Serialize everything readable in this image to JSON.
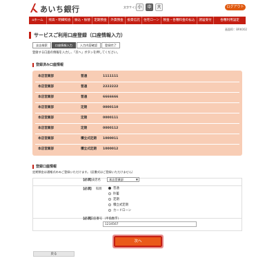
{
  "header": {
    "bank_name": "あいち銀行",
    "font_size_label": "文字サイズ変更",
    "font_sizes": [
      "小",
      "中",
      "大"
    ],
    "logout_label": "ログアウト"
  },
  "nav": {
    "items": [
      "ホーム",
      "残高・明細照会",
      "振込・振替",
      "定期預金",
      "外貨預金",
      "投資信託",
      "住宅ローン",
      "税金・各種料金の払込",
      "諸届受付",
      "各種利用設定"
    ]
  },
  "screen_id": "画面ID：BRK002",
  "page_title": "サービスご利用口座登録（口座情報入力）",
  "steps": [
    "支店検索",
    "口座情報入力",
    "入力内容確認",
    "登録完了"
  ],
  "instruction": "登録する口座の情報を入力し、「次へ」ボタンを押してください。",
  "registered": {
    "heading": "登録済み口座情報",
    "rows": [
      {
        "branch": "本店営業部",
        "type": "普通",
        "number": "1111111"
      },
      {
        "branch": "本店営業部",
        "type": "普通",
        "number": "2222222"
      },
      {
        "branch": "本店営業部",
        "type": "普通",
        "number": "6666666"
      },
      {
        "branch": "本店営業部",
        "type": "定期",
        "number": "0000110"
      },
      {
        "branch": "本店営業部",
        "type": "定期",
        "number": "0000111"
      },
      {
        "branch": "本店営業部",
        "type": "定期",
        "number": "0000112"
      },
      {
        "branch": "本店営業部",
        "type": "積立式定期",
        "number": "1000011"
      },
      {
        "branch": "本店営業部",
        "type": "積立式定期",
        "number": "1000012"
      }
    ]
  },
  "registration": {
    "heading": "登録口座情報",
    "note": "定期預金は通帳式のみご登録いただけます。（証書式はご登録いただけません）",
    "required": "【必須】",
    "branch_label": "支店名",
    "branch_value": "本店営業部",
    "subject_label": "科目",
    "subjects": [
      "普通",
      "貯蓄",
      "定期",
      "積立式定期",
      "カードローン"
    ],
    "selected_subject": "普通",
    "account_label": "口座番号",
    "account_hint": "（半角数字）",
    "account_value": "1234567"
  },
  "buttons": {
    "next": "次へ",
    "back": "戻る"
  }
}
